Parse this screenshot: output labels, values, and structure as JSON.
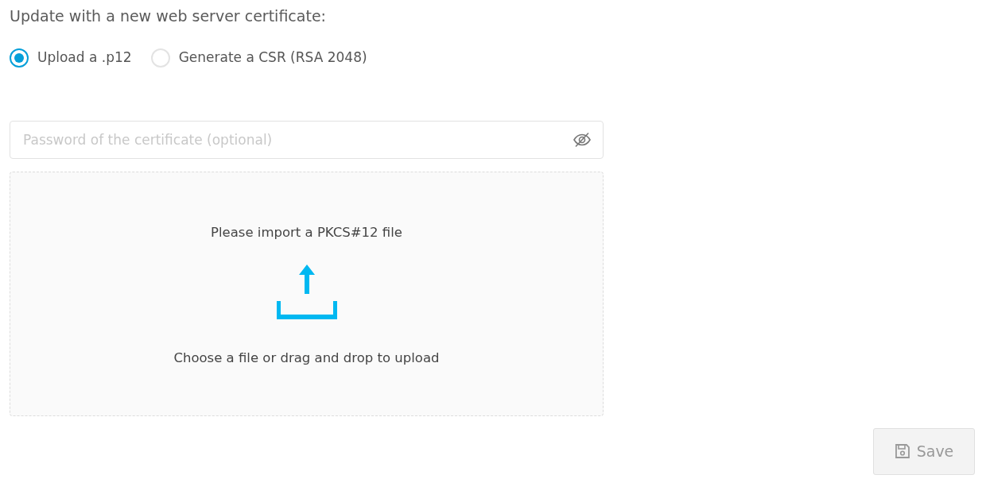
{
  "heading": "Update with a new web server certificate:",
  "options": [
    {
      "label": "Upload a .p12",
      "selected": true
    },
    {
      "label": "Generate a CSR (RSA 2048)",
      "selected": false
    }
  ],
  "password": {
    "placeholder": "Password of the certificate (optional)"
  },
  "dropzone": {
    "prompt": "Please import a PKCS#12 file",
    "hint": "Choose a file or drag and drop to upload"
  },
  "save_button": {
    "label": "Save",
    "disabled": true
  }
}
